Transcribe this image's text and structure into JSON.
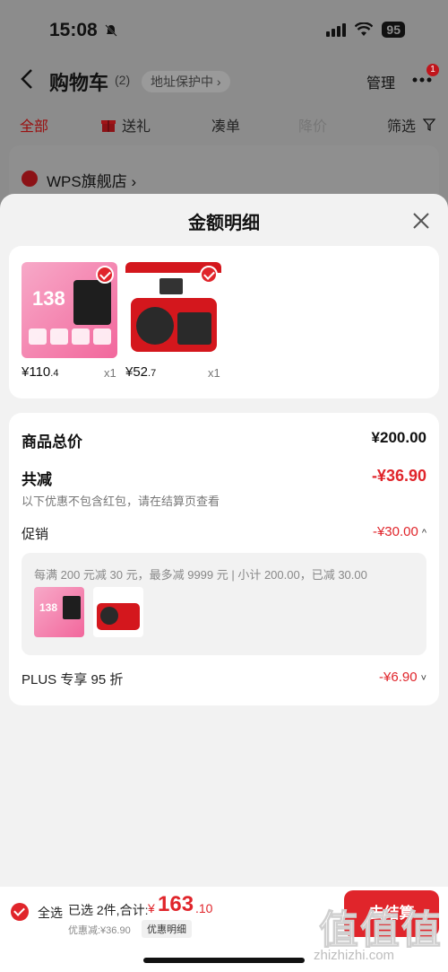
{
  "status_bar": {
    "time": "15:08",
    "battery": "95"
  },
  "cart_header": {
    "title": "购物车",
    "count": "(2)",
    "address_protect": "地址保护中 ›",
    "manage_label": "管理",
    "more_badge": "1"
  },
  "tabs": [
    {
      "label": "全部"
    },
    {
      "label": "送礼"
    },
    {
      "label": "凑单"
    },
    {
      "label": "降价"
    },
    {
      "label": "筛选"
    }
  ],
  "store": {
    "name": "WPS旗舰店 ›"
  },
  "sheet": {
    "title": "金额明细"
  },
  "products": [
    {
      "price_int": "¥110",
      "price_dec": ".4",
      "qty": "x1",
      "thumb_text": "138"
    },
    {
      "price_int": "¥52",
      "price_dec": ".7",
      "qty": "x1"
    }
  ],
  "summary": {
    "total_label": "商品总价",
    "total_value": "¥200.00",
    "reduce_label": "共减",
    "reduce_value": "-¥36.90",
    "reduce_note": "以下优惠不包含红包，请在结算页查看",
    "promo_label": "促销",
    "promo_value": "-¥30.00",
    "promo_desc": "每满 200 元减 30 元，最多减 9999 元 | 小计 200.00，已减 30.00",
    "promo_thumb_text": "138",
    "plus_label": "PLUS 专享 95 折",
    "plus_value": "-¥6.90"
  },
  "checkout": {
    "select_all": "全选",
    "selected_text": "已选 2件,合计:",
    "total_symbol": "¥",
    "total_int": "163",
    "total_dec": ".10",
    "discount_text": "优惠减:¥36.90",
    "detail_btn": "优惠明细",
    "checkout_btn": "去结算"
  },
  "watermark": {
    "logo": "值值值",
    "url": "zhizhizhi.com"
  },
  "colors": {
    "accent": "#e0252b",
    "sheet_bg": "#f2f2f2",
    "overlay": "#8c8c8c"
  }
}
